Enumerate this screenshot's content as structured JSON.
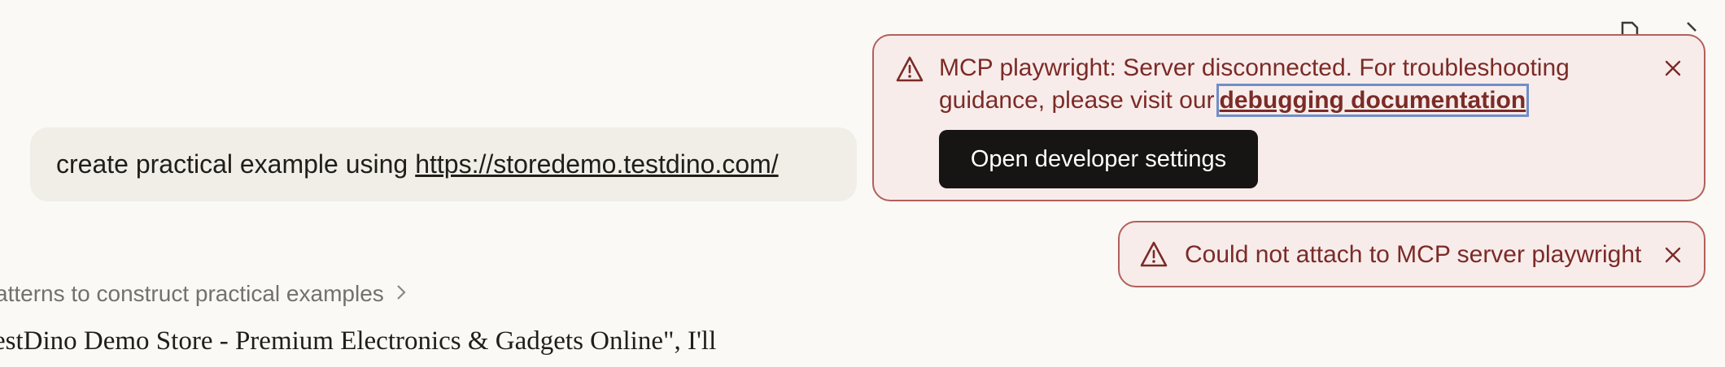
{
  "conversation": {
    "user_prompt_text": "create practical example using",
    "user_prompt_link": "https://storedemo.testdino.com/",
    "thinking_summary": "atterns to construct practical examples",
    "response_fragment": "estDino Demo Store - Premium Electronics & Gadgets Online\", I'll"
  },
  "header": {
    "icons": [
      "document-icon",
      "arrow-icon"
    ]
  },
  "toasts": {
    "mcp_disconnected": {
      "icon": "warning-icon",
      "message": "MCP playwright: Server disconnected. For troubleshooting guidance, please visit our",
      "link_label": "debugging documentation",
      "button_label": "Open developer settings",
      "close_icon": "close-icon"
    },
    "attach_failed": {
      "icon": "warning-icon",
      "message": "Could not attach to MCP server playwright",
      "close_icon": "close-icon"
    }
  },
  "colors": {
    "page_bg": "#faf9f5",
    "toast_bg": "#f8eceb",
    "toast_border": "#b2605b",
    "toast_text": "#7b2b26",
    "button_bg": "#161513",
    "focus_ring": "#6f8fc8"
  }
}
